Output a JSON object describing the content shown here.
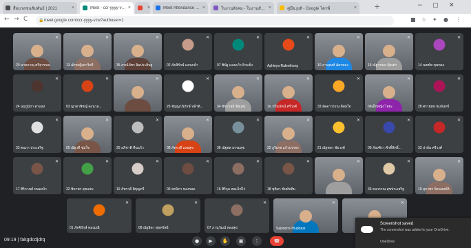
{
  "browser": {
    "tabs": [
      {
        "title": "สื่อมวลชนสัมพันธ์ | 2021",
        "color": "#4a4a4a",
        "active": false
      },
      {
        "title": "Meet - ccr-yyyy-vzw",
        "color": "#00897b",
        "active": true
      },
      {
        "title": "",
        "color": "#ea4335",
        "active": false
      },
      {
        "title": "Meet Attendance Monitor",
        "color": "#1a73e8",
        "active": false
      },
      {
        "title": "ใบงานสังคม - ใบงานสังคมศึกษา",
        "color": "#7e57c2",
        "active": false
      },
      {
        "title": "คู่มือ.pdf - Google ไดรฟ์",
        "color": "#fbbc04",
        "active": false
      }
    ],
    "new_tab": "+",
    "window_controls": {
      "minimize": "−",
      "maximize": "▢",
      "close": "✕"
    },
    "nav": {
      "back": "←",
      "forward": "→",
      "reload": "C"
    },
    "url": "meet.google.com/ccr-yyyy-vzw?authuser=1"
  },
  "meeting": {
    "participants": [
      {
        "name": "20 นายภาณุ ศรีสุวรรณ",
        "avatar_color": "#6d4c41",
        "video": true
      },
      {
        "name": "13 เด็กหญิงสาวิตรี",
        "avatar_color": "#8d6e63",
        "video": true
      },
      {
        "name": "35 ภรณ์ภัทร ลิมประดิษฐ",
        "avatar_color": "#5d4037",
        "video": true
      },
      {
        "name": "02 ภัคจิรักษ์ แสนกล้า",
        "avatar_color": "#c79b8b",
        "video": false
      },
      {
        "name": "07 ชินัฐ แสงแก้ว ผิวแข็ง",
        "avatar_color": "#00897b",
        "video": false
      },
      {
        "name": "Aphinya Rakmthong",
        "avatar_color": "#e64a19",
        "video": false
      },
      {
        "name": "10 ภานุพงศ์ ฉัตรทอง",
        "avatar_color": "#1e88e5",
        "video": true
      },
      {
        "name": "15 ณัฐวรรณ ตุ้ยเต่า",
        "avatar_color": "#9e9e9e",
        "video": true
      },
      {
        "name": "14 ณหทัย ขุนทอง",
        "avatar_color": "#ab47bc",
        "video": false
      },
      {
        "name": "24 นฤภูมิภา ตาแสง",
        "avatar_color": "#4e342e",
        "video": false
      },
      {
        "name": "03 ญาดาพิชญ์ คงนวล...",
        "avatar_color": "#d84315",
        "video": false
      },
      {
        "name": "",
        "avatar_color": "#6d4c41",
        "video": true
      },
      {
        "name": "26 ชัญญานิภักษ์ หล้าทิ...",
        "avatar_color": "#ffffff",
        "video": false
      },
      {
        "name": "34 ชัชวาลย์ ชัยเสน",
        "avatar_color": "#9e9e9e",
        "video": true
      },
      {
        "name": "1ธ ปวีณรัตน์ ศรีวงศ์",
        "avatar_color": "#c62828",
        "video": true
      },
      {
        "name": "33 ลัดดาวรรณ ดีสมใจ",
        "avatar_color": "#f9a825",
        "video": false
      },
      {
        "name": "06เด็กหญิง ไสยะ",
        "avatar_color": "#8e24aa",
        "video": true
      },
      {
        "name": "28 ศรายุทธ ชมจันทร์",
        "avatar_color": "#ad1457",
        "video": false
      },
      {
        "name": "33 ตนภา ประเสริฐ",
        "avatar_color": "#e0e0e0",
        "video": false
      },
      {
        "name": "05 ณัฐวดี ชุ่มใจ",
        "avatar_color": "#795548",
        "video": true
      },
      {
        "name": "25 อภิชาติ ทีนแก้ว",
        "avatar_color": "#bdbdbd",
        "video": false
      },
      {
        "name": "08 ภัทรวดี เมฆสุข",
        "avatar_color": "#d84315",
        "video": true
      },
      {
        "name": "36 ณัฐพล ธรรมสุข",
        "avatar_color": "#78909c",
        "video": false
      },
      {
        "name": "32 ภูริเดช แก้วบรรจง",
        "avatar_color": "#8d6e63",
        "video": true
      },
      {
        "name": "21 ณัฐชลา ชัยวงศ์",
        "avatar_color": "#fbc02d",
        "video": false
      },
      {
        "name": "09 ภัณฑิรา ศักดิ์สิทธิ์...",
        "avatar_color": "#3949ab",
        "video": false
      },
      {
        "name": "33 ปาล์ม ศรีวงศ์",
        "avatar_color": "#c62828",
        "video": false
      },
      {
        "name": "17 ศิริกานต์ หนองบัว",
        "avatar_color": "#795548",
        "video": false
      },
      {
        "name": "32 ชิตาพร สุขแจ่ม",
        "avatar_color": "#43a047",
        "video": false
      },
      {
        "name": "19 ภัทรวดี ติบุญทวี",
        "avatar_color": "#d7ccc8",
        "video": false
      },
      {
        "name": "06 พรนิภา ทองรอด",
        "avatar_color": "#6d4c41",
        "video": false
      },
      {
        "name": "16 ศิริกุล หอมไฟไร่",
        "avatar_color": "#8d6e63",
        "video": false
      },
      {
        "name": "18 ชุติมา ขันทับทิม",
        "avatar_color": "#795548",
        "video": false
      },
      {
        "name": "",
        "avatar_color": "#9e9e9e",
        "video": true
      },
      {
        "name": "36 ธนวรรณ สุขประเสริฐ",
        "avatar_color": "#e0c9a6",
        "video": false
      },
      {
        "name": "19 สุภาพร รัตนสมบัติ",
        "avatar_color": "#8d6e63",
        "video": true
      },
      {
        "name": "01 ภัคจิรักษ์ ทองมณี",
        "avatar_color": "#ef6c00",
        "video": false
      },
      {
        "name": "08 ณัฐธิดา สุขทรัพย์",
        "avatar_color": "#c0a060",
        "video": false
      },
      {
        "name": "07 ภานุวัฒน์ ทองสุข",
        "avatar_color": "#8d6e63",
        "video": false
      },
      {
        "name": "Saiynorn Phuphasr",
        "avatar_color": "#0277bd",
        "video": true
      },
      {
        "name": "",
        "avatar_color": "#795548",
        "video": true
      }
    ]
  },
  "controls": {
    "time": "09:19",
    "meeting_code": "fakgdcdjdrq",
    "icons": [
      "mic",
      "camera",
      "hand",
      "present",
      "more",
      "end"
    ]
  },
  "notification": {
    "title": "Screenshot saved",
    "body": "The screenshot was added to your OneDrive.",
    "source": "OneDrive"
  },
  "colors": {
    "background": "#202124",
    "tile": "#3c4043",
    "end_call": "#ea4335",
    "active_speaker": "#8ab4f8"
  }
}
